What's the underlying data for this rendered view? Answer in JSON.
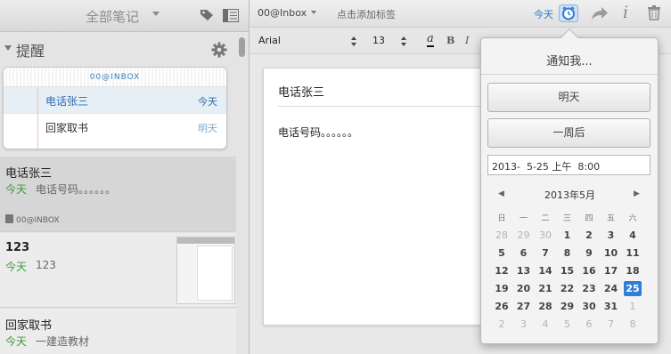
{
  "sidebar": {
    "notebook_title": "全部笔记",
    "reminders": {
      "title": "提醒",
      "card_header": "00@INBOX",
      "items": [
        {
          "name": "电话张三",
          "when": "今天"
        },
        {
          "name": "回家取书",
          "when": "明天"
        }
      ]
    },
    "notes": [
      {
        "title": "电话张三",
        "date": "今天",
        "snippet": "电话号码。。。。。。",
        "notebook": "00@INBOX"
      },
      {
        "title": "123",
        "date": "今天",
        "snippet": "123"
      },
      {
        "title": "回家取书",
        "date": "今天",
        "snippet": "一建造教材"
      }
    ]
  },
  "editor": {
    "notebook": "00@Inbox",
    "tag_placeholder": "点击添加标签",
    "reminder_date": "今天",
    "font": "Arial",
    "font_size": "13",
    "color_label": "a",
    "bold_label": "B",
    "italic_label": "I",
    "note_title": "电话张三",
    "note_body": "电话号码。。。。。。"
  },
  "popover": {
    "title": "通知我...",
    "tomorrow": "明天",
    "week_later": "一周后",
    "datetime": "2013-  5-25 上午  8:00",
    "calendar": {
      "month": "2013年5月",
      "prev": "◀",
      "next": "▶",
      "weekdays": [
        "日",
        "一",
        "二",
        "三",
        "四",
        "五",
        "六"
      ],
      "weeks": [
        [
          "28",
          "29",
          "30",
          "1",
          "2",
          "3",
          "4"
        ],
        [
          "5",
          "6",
          "7",
          "8",
          "9",
          "10",
          "11"
        ],
        [
          "12",
          "13",
          "14",
          "15",
          "16",
          "17",
          "18"
        ],
        [
          "19",
          "20",
          "21",
          "22",
          "23",
          "24",
          "25"
        ],
        [
          "26",
          "27",
          "28",
          "29",
          "30",
          "31",
          "1"
        ],
        [
          "2",
          "3",
          "4",
          "5",
          "6",
          "7",
          "8"
        ]
      ],
      "muted": [
        [
          0,
          0
        ],
        [
          0,
          1
        ],
        [
          0,
          2
        ],
        [
          4,
          6
        ],
        [
          5,
          0
        ],
        [
          5,
          1
        ],
        [
          5,
          2
        ],
        [
          5,
          3
        ],
        [
          5,
          4
        ],
        [
          5,
          5
        ],
        [
          5,
          6
        ]
      ],
      "selected": [
        3,
        6
      ]
    }
  },
  "colors": {
    "accent": "#2f7fd6",
    "date_green": "#3d9a36",
    "link_blue": "#2f78c4"
  }
}
